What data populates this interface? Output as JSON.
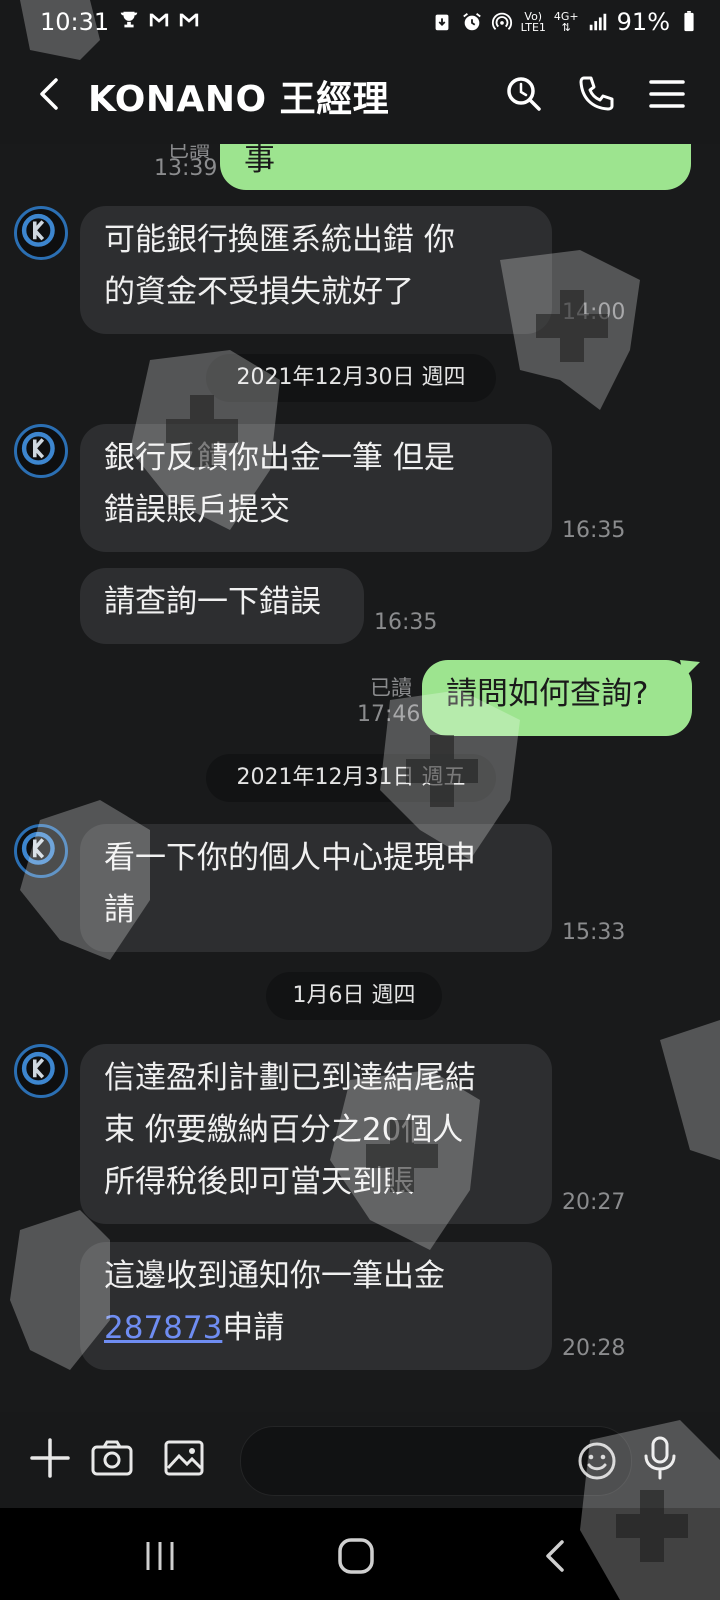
{
  "status_bar": {
    "time": "10:31",
    "battery_percent": "91%",
    "network_top": "Vo)",
    "network_bottom": "LTE1",
    "data_top": "4G+"
  },
  "header": {
    "title": "KONANO 王經理"
  },
  "messages": {
    "partial_out": {
      "text": "事",
      "read": "已讀",
      "time": "13:39"
    },
    "m1": {
      "line1": "可能銀行換匯系統出錯  你",
      "line2": "的資金不受損失就好了",
      "time": "14:00"
    },
    "date1": "2021年12月30日 週四",
    "m2": {
      "line1": "銀行反饋你出金一筆  但是",
      "line2": "錯誤賬戶提交",
      "time": "16:35"
    },
    "m3": {
      "text": "請查詢一下錯誤",
      "time": "16:35"
    },
    "m4": {
      "text": "請問如何查詢?",
      "read": "已讀",
      "time": "17:46"
    },
    "date2": "2021年12月31日 週五",
    "m5": {
      "line1": "看一下你的個人中心提現申",
      "line2": "請",
      "time": "15:33"
    },
    "date3": "1月6日 週四",
    "m6": {
      "line1": "信達盈利計劃已到達結尾結",
      "line2": "束  你要繳納百分之20個人",
      "line3": "所得稅後即可當天到賬",
      "time": "20:27"
    },
    "m7": {
      "line1": "這邊收到通知你一筆出金",
      "link": "287873",
      "line2_rest": "申請",
      "time": "20:28"
    }
  },
  "input": {
    "placeholder": ""
  },
  "colors": {
    "outgoing_bubble": "#9de48f",
    "incoming_bubble": "#2d2e30",
    "link": "#6f8df2",
    "background": "#191a1b"
  }
}
